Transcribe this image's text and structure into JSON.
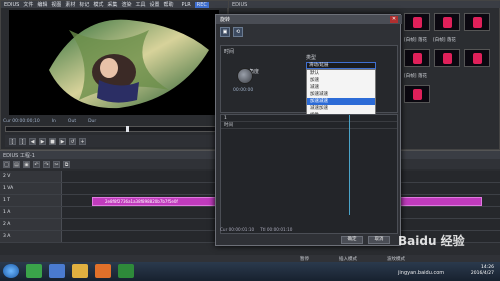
{
  "player": {
    "app_name": "EDIUS",
    "menu": [
      "文件",
      "编辑",
      "视图",
      "素材",
      "标记",
      "模式",
      "采集",
      "渲染",
      "工具",
      "设置",
      "帮助"
    ],
    "mode": "PLR",
    "mode_badge": "REC",
    "timecode_cur": "Cur 00:00:00;10",
    "timecode_in": "In",
    "timecode_out": "Out",
    "timecode_dur": "Dur"
  },
  "bins": {
    "title": "EDIUS",
    "thumbs": [
      {
        "label": "[白帧] 落花"
      },
      {
        "label": "[白帧] 落花"
      },
      {
        "label": "[白帧] 落花"
      }
    ]
  },
  "dialog": {
    "title": "旋转",
    "section_time": "时间",
    "section_right": "类型",
    "knob_label": "角度",
    "knob_value": "00:00:00",
    "select_value": "滑动/延展",
    "options": [
      "默认",
      "加速",
      "减速",
      "加速减速",
      "加速减速",
      "减速加速",
      "线性"
    ],
    "selected_index": 4,
    "track_rows": [
      "1",
      "时间"
    ],
    "status_cur": "Cur 00:00:01:10",
    "status_ttl": "Ttl 00:00:01:10",
    "ok": "确定",
    "cancel": "取消"
  },
  "timeline": {
    "title": "EDIUS 工程-1",
    "tracks": [
      "2 V",
      "1 VA",
      "1 T",
      "1 A",
      "2 A",
      "3 A"
    ],
    "clip_label": "2e8f8f2736a1a38f898820b7b7f5e0f",
    "status_left": "暂停",
    "status_mid": "插入模式",
    "status_right": "波纹模式"
  },
  "taskbar": {
    "time": "14:26",
    "date": "2016/4/27"
  },
  "watermark": {
    "brand": "Baidu 经验",
    "url": "jingyan.baidu.com"
  },
  "colors": {
    "accent": "#3f6fd0",
    "clip": "#c03bbd",
    "selection": "#2c6bd6"
  }
}
